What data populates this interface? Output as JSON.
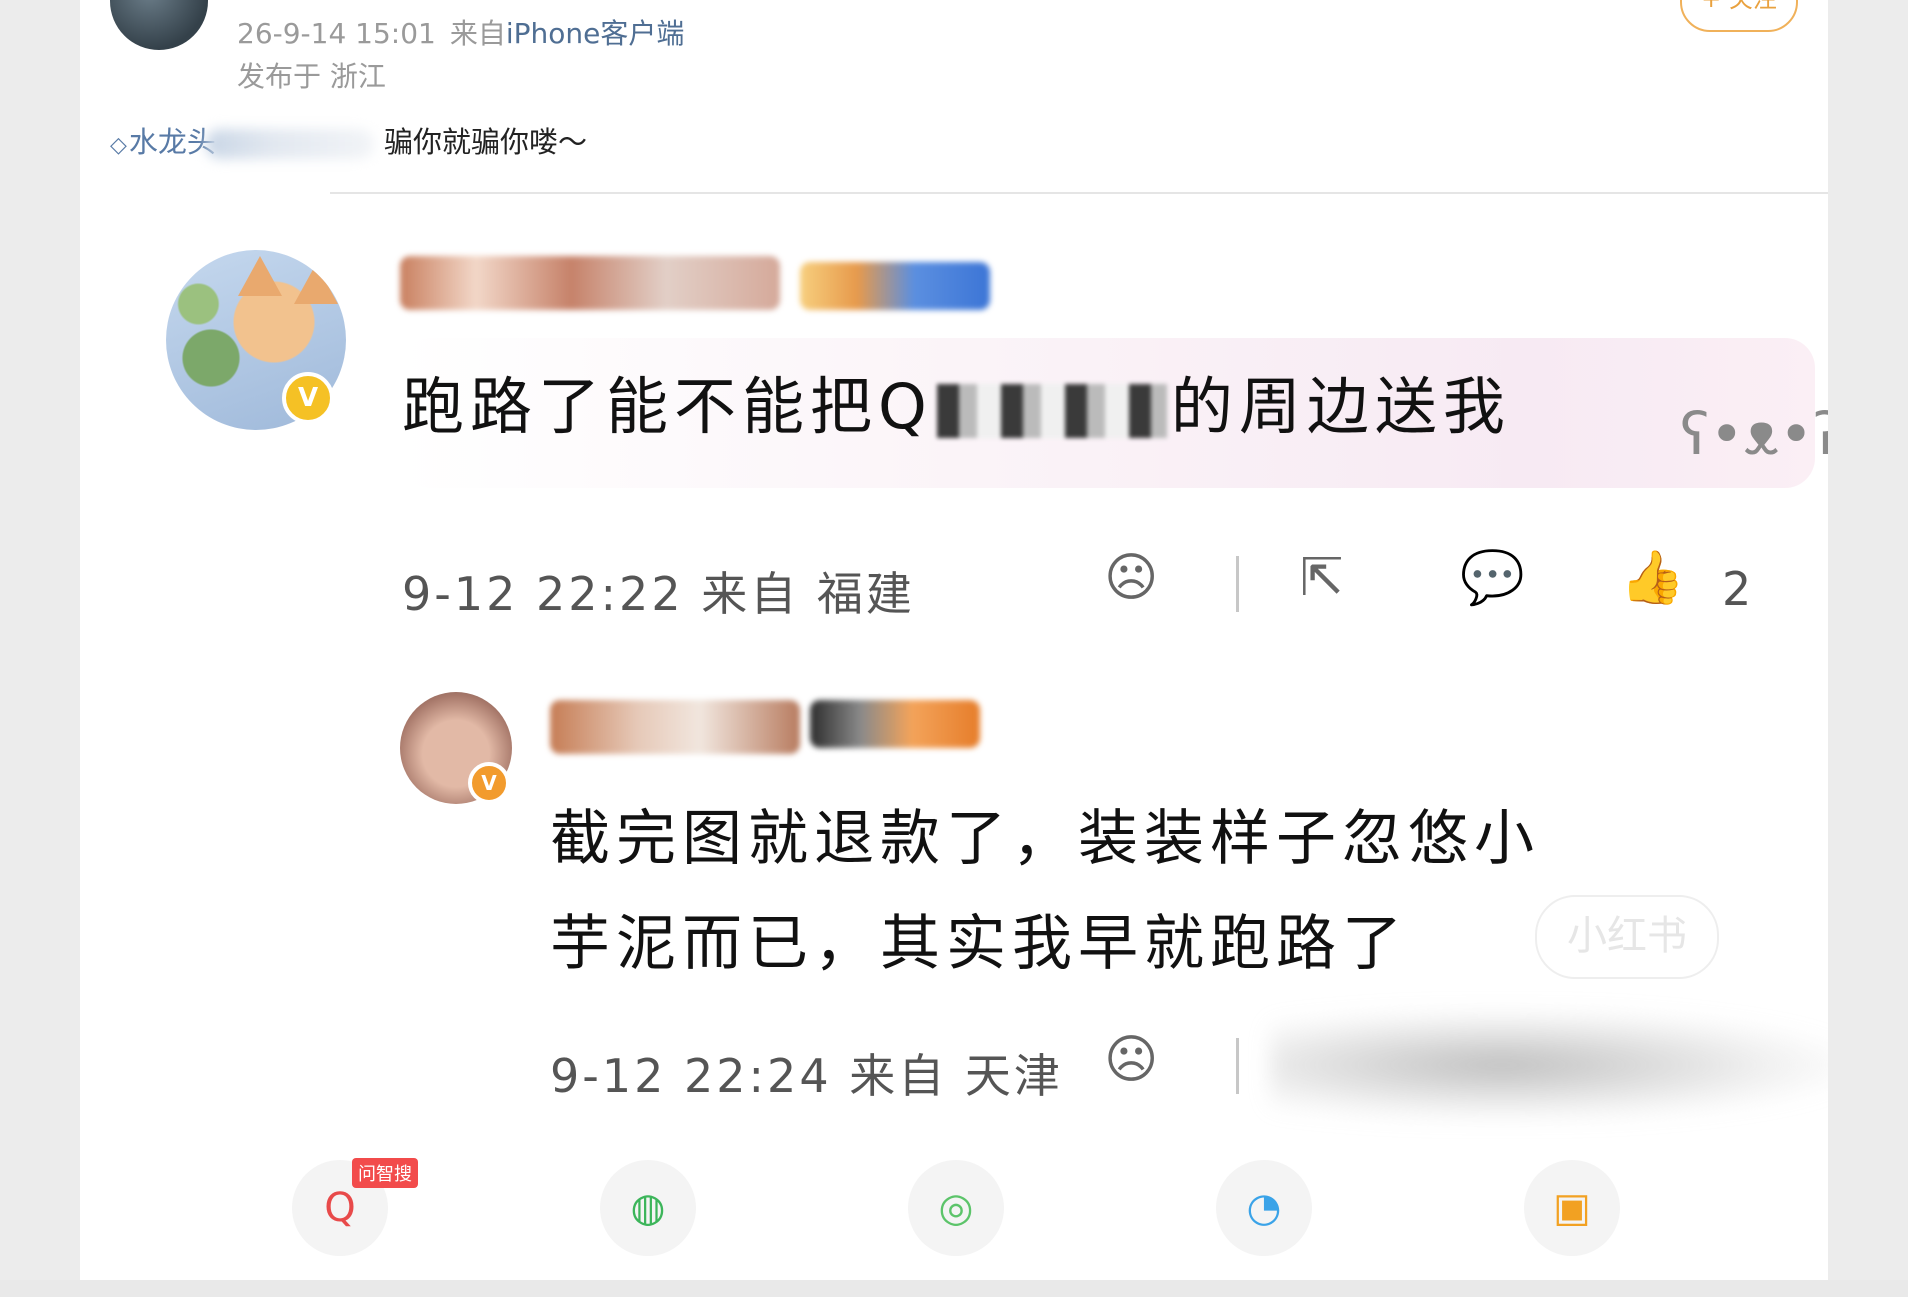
{
  "post": {
    "time": "26-9-14 15:01",
    "source_prefix": "来自",
    "source": "iPhone客户端",
    "location": "发布于 浙江",
    "follow_label": "+ 关注",
    "topic_tag": "水龙头",
    "body": "骗你就骗你喽～"
  },
  "comment_1": {
    "text_before": "跑路了能不能把",
    "search_glyph": "Q",
    "text_after": "的周边送我",
    "meta": "9-12 22:22 来自 福建",
    "like_count": "2",
    "icons": [
      "sad-face-icon",
      "share-icon",
      "comment-icon",
      "thumbs-up-icon"
    ]
  },
  "comment_2": {
    "line_1": "截完图就退款了，装装样子忽悠小",
    "line_2": "芋泥而已，其实我早就跑路了",
    "meta": "9-12 22:24 来自 天津",
    "watermark": "小红书",
    "icons": [
      "sad-face-icon"
    ]
  },
  "share_bar": {
    "tag": "问智搜",
    "items": [
      "search-ai-icon",
      "wechat-icon",
      "moments-icon",
      "qq-icon",
      "save-image-icon"
    ]
  },
  "colors": {
    "link_blue": "#587aa6",
    "follow_orange": "#e9a13e",
    "badge_yellow": "#f5c125",
    "tag_red": "#f24b4b"
  }
}
